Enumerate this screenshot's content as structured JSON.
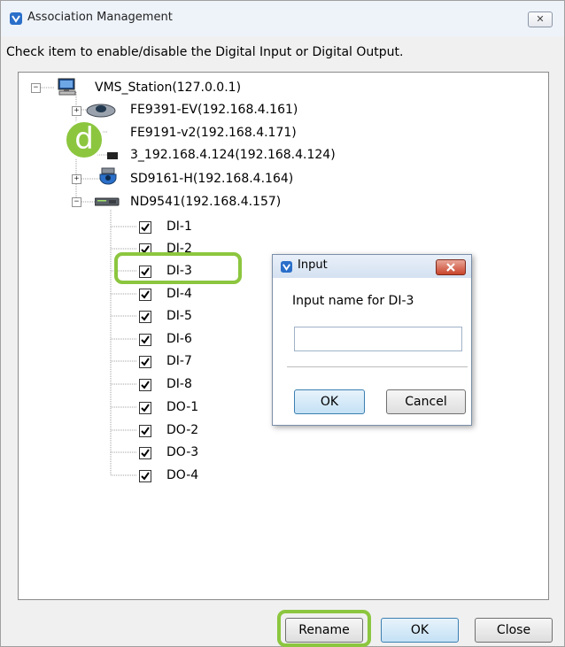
{
  "window": {
    "title": "Association Management",
    "close_glyph": "✕"
  },
  "instructions": "Check item to enable/disable the Digital Input or Digital Output.",
  "tree": {
    "root": {
      "label": "VMS_Station(127.0.0.1)",
      "icon": "computer-icon",
      "expanded": true
    },
    "devices": [
      {
        "label": "FE9391-EV(192.168.4.161)",
        "icon": "fisheye-camera-icon",
        "expanded": false
      },
      {
        "label": "FE9191-v2(192.168.4.171)",
        "icon": "fisheye-camera-icon",
        "expanded": false
      },
      {
        "label": "3_192.168.4.124(192.168.4.124)",
        "icon": "camera-icon",
        "expanded": false
      },
      {
        "label": "SD9161-H(192.168.4.164)",
        "icon": "speed-dome-icon",
        "expanded": false
      },
      {
        "label": "ND9541(192.168.4.157)",
        "icon": "nvr-icon",
        "expanded": true
      }
    ],
    "io_items": [
      {
        "label": "DI-1",
        "checked": true
      },
      {
        "label": "DI-2",
        "checked": true
      },
      {
        "label": "DI-3",
        "checked": true
      },
      {
        "label": "DI-4",
        "checked": true
      },
      {
        "label": "DI-5",
        "checked": true
      },
      {
        "label": "DI-6",
        "checked": true
      },
      {
        "label": "DI-7",
        "checked": true
      },
      {
        "label": "DI-8",
        "checked": true
      },
      {
        "label": "DO-1",
        "checked": true
      },
      {
        "label": "DO-2",
        "checked": true
      },
      {
        "label": "DO-3",
        "checked": true
      },
      {
        "label": "DO-4",
        "checked": true
      }
    ]
  },
  "callout": {
    "letter": "d",
    "color": "#8cc63f"
  },
  "dialog": {
    "title": "Input",
    "prompt": "Input name for DI-3",
    "input_value": "",
    "ok_label": "OK",
    "cancel_label": "Cancel"
  },
  "buttons": {
    "rename": "Rename",
    "ok": "OK",
    "close": "Close"
  },
  "colors": {
    "highlight": "#8cc63f",
    "accent": "#3c7fb1",
    "dialog_close": "#c9452d"
  }
}
